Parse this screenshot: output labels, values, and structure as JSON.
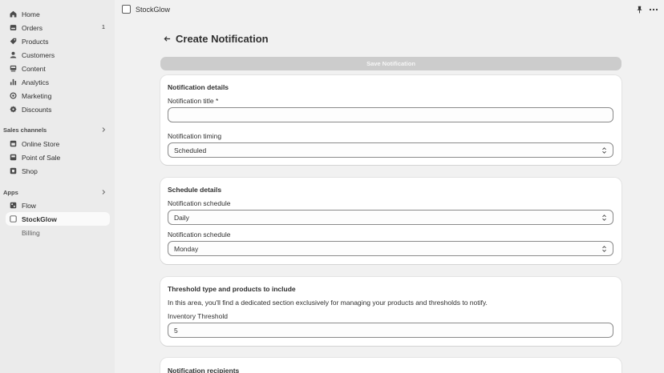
{
  "sidebar": {
    "nav": [
      {
        "label": "Home",
        "icon": "home-icon"
      },
      {
        "label": "Orders",
        "icon": "orders-icon",
        "badge": "1"
      },
      {
        "label": "Products",
        "icon": "tag-icon"
      },
      {
        "label": "Customers",
        "icon": "person-icon"
      },
      {
        "label": "Content",
        "icon": "content-icon"
      },
      {
        "label": "Analytics",
        "icon": "bar-chart-icon"
      },
      {
        "label": "Marketing",
        "icon": "target-icon"
      },
      {
        "label": "Discounts",
        "icon": "discount-icon"
      }
    ],
    "sales_channels_label": "Sales channels",
    "channels": [
      {
        "label": "Online Store",
        "icon": "store-icon"
      },
      {
        "label": "Point of Sale",
        "icon": "pos-icon"
      },
      {
        "label": "Shop",
        "icon": "shop-icon"
      }
    ],
    "apps_label": "Apps",
    "apps": [
      {
        "label": "Flow",
        "icon": "flow-icon"
      },
      {
        "label": "StockGlow",
        "icon": "app-icon"
      }
    ],
    "app_sub": {
      "label": "Billing"
    }
  },
  "topbar": {
    "title": "StockGlow"
  },
  "page": {
    "title": "Create Notification",
    "save_label": "Save Notification"
  },
  "notification_details": {
    "title": "Notification details",
    "title_label": "Notification title *",
    "title_value": "",
    "timing_label": "Notification timing",
    "timing_value": "Scheduled"
  },
  "schedule_details": {
    "title": "Schedule details",
    "schedule1_label": "Notification schedule",
    "schedule1_value": "Daily",
    "schedule2_label": "Notification schedule",
    "schedule2_value": "Monday"
  },
  "threshold": {
    "title": "Threshold type and products to include",
    "description": "In this area, you'll find a dedicated section exclusively for managing your products and thresholds to notify.",
    "inventory_label": "Inventory Threshold",
    "inventory_value": "5"
  },
  "recipients": {
    "title": "Notification recipients"
  },
  "colors": {
    "sidebar_bg": "#ebebeb",
    "main_bg": "#f1f1f1",
    "card_bg": "#ffffff",
    "disabled_button": "#cccccc"
  }
}
